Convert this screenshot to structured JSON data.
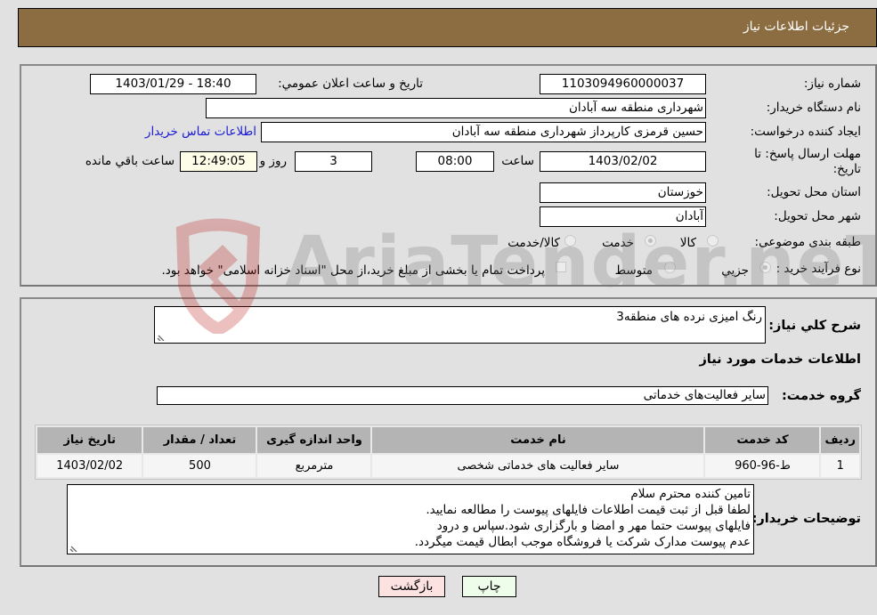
{
  "header": {
    "title": "جزئيات اطلاعات نياز"
  },
  "form": {
    "need_number": {
      "label": "شماره نیاز:",
      "value": "1103094960000037"
    },
    "announce_datetime": {
      "label": "تاريخ و ساعت اعلان عمومي:",
      "value": "1403/01/29 - 18:40"
    },
    "buyer_org": {
      "label": "نام دستگاه خریدار:",
      "value": "شهرداری منطقه سه آبادان"
    },
    "requester": {
      "label": "ایجاد کننده درخواست:",
      "value": "حسین قرمزی کارپرداز شهرداری منطقه سه آبادان"
    },
    "buyer_contact_link": "اطلاعات تماس خریدار",
    "deadline": {
      "label_line1": "مهلت ارسال پاسخ: تا",
      "label_line2": "تاریخ:",
      "date": "1403/02/02",
      "time_label": "ساعت",
      "time": "08:00",
      "days": "3",
      "days_label": "روز و",
      "remaining": "12:49:05",
      "remaining_label": "ساعت باقي مانده"
    },
    "province": {
      "label": "استان محل تحویل:",
      "value": "خوزستان"
    },
    "city": {
      "label": "شهر محل تحویل:",
      "value": "آبادان"
    },
    "category": {
      "label": "طبقه بندی موضوعی:",
      "options": [
        {
          "label": "کالا",
          "checked": false
        },
        {
          "label": "خدمت",
          "checked": true
        },
        {
          "label": "کالا/خدمت",
          "checked": false
        }
      ]
    },
    "purchase_type": {
      "label": "نوع فرآیند خرید :",
      "options": [
        {
          "label": "جزيي",
          "checked": true
        },
        {
          "label": "متوسط",
          "checked": false
        }
      ],
      "treasury_note": "پرداخت تمام یا بخشی از مبلغ خرید،از محل \"اسناد خزانه اسلامی\" خواهد بود."
    }
  },
  "details": {
    "general_desc_label": "شرح كلي نياز:",
    "general_desc_value": "رنگ امیزی نرده های منطقه3",
    "services_heading": "اطلاعات خدمات مورد نياز",
    "service_group_label": "گروه خدمت:",
    "service_group_value": "سایر فعالیت‌های خدماتی",
    "table": {
      "headers": [
        "ردیف",
        "کد خدمت",
        "نام خدمت",
        "واحد اندازه گیری",
        "تعداد / مقدار",
        "تاریخ نیاز"
      ],
      "rows": [
        [
          "1",
          "ط-96-960",
          "سایر فعالیت های خدماتی شخصی",
          "مترمربع",
          "500",
          "1403/02/02"
        ]
      ]
    },
    "buyer_notes_label": "توضیحات خریدار:",
    "buyer_notes_lines": [
      "تامین کننده محترم سلام",
      "لطفا قبل از ثبت قیمت اطلاعات فایلهای پیوست را مطالعه نمایید.",
      "فایلهای پیوست حتما مهر و امضا و بارگزاری شود.سپاس و درود",
      "عدم پیوست مدارک شرکت یا فروشگاه موجب ابطال قیمت میگردد."
    ]
  },
  "actions": {
    "print": "چاپ",
    "back": "بازگشت"
  },
  "watermark": {
    "text": "AriaTender.neT"
  },
  "colors": {
    "header_bg": "#8c6d42",
    "link": "#1a1ad6",
    "print_bg": "#eefde9",
    "back_bg": "#fde2e2"
  }
}
